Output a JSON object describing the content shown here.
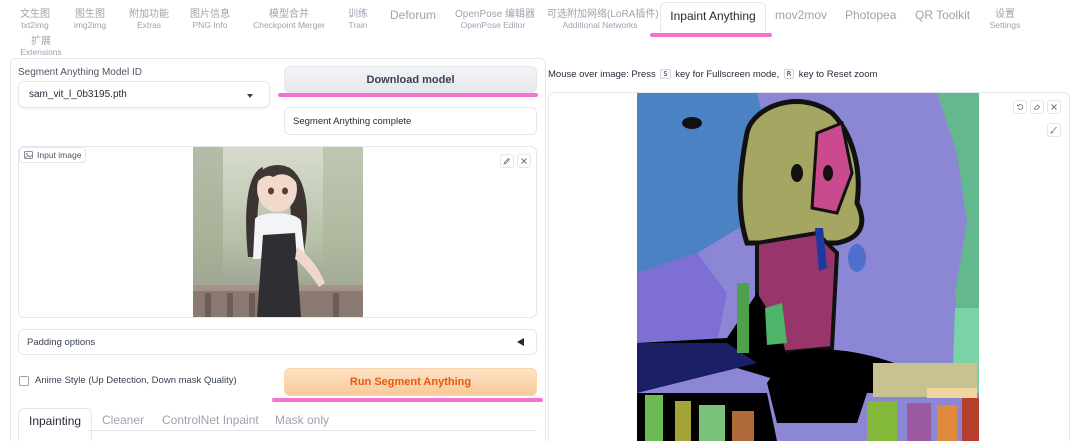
{
  "top_tabs": [
    {
      "line1": "文生图",
      "line2": "txt2img"
    },
    {
      "line1": "图生图",
      "line2": "img2img"
    },
    {
      "line1": "附加功能",
      "line2": "Extras"
    },
    {
      "line1": "图片信息",
      "line2": "PNG Info"
    },
    {
      "line1": "模型合并",
      "line2": "Checkpoint Merger"
    },
    {
      "line1": "训练",
      "line2": "Train"
    },
    {
      "label": "Deforum"
    },
    {
      "line1": "OpenPose 编辑器",
      "line2": "OpenPose Editor"
    },
    {
      "line1": "可选附加网络(LoRA插件)",
      "line2": "Additional Networks"
    },
    {
      "label": "Inpaint Anything",
      "active": true
    },
    {
      "label": "mov2mov"
    },
    {
      "label": "Photopea"
    },
    {
      "label": "QR Toolkit"
    },
    {
      "line1": "设置",
      "line2": "Settings"
    },
    {
      "line1": "扩展",
      "line2": "Extensions"
    }
  ],
  "model": {
    "label": "Segment Anything Model ID",
    "selected": "sam_vit_l_0b3195.pth"
  },
  "download_button": "Download model",
  "status_text": "Segment Anything complete",
  "input_image": {
    "label": "Input image",
    "edit_icon": "pencil-icon",
    "close_icon": "close-icon"
  },
  "padding_options": "Padding options",
  "anime_style": {
    "label": "Anime Style (Up Detection, Down mask Quality)",
    "checked": false
  },
  "run_button": "Run Segment Anything",
  "sub_tabs": [
    "Inpainting",
    "Cleaner",
    "ControlNet Inpaint",
    "Mask only"
  ],
  "hint": {
    "prefix": "Mouse over image: Press",
    "key1": "S",
    "middle": "key for Fullscreen mode,",
    "key2": "R",
    "suffix": "key to Reset zoom"
  },
  "seg_image_icons": [
    "undo-icon",
    "clear-icon",
    "close-icon",
    "brush-icon"
  ],
  "colors": {
    "accent": "#f472d0",
    "run_button_text": "#ea580c",
    "border": "#e5e7eb"
  }
}
